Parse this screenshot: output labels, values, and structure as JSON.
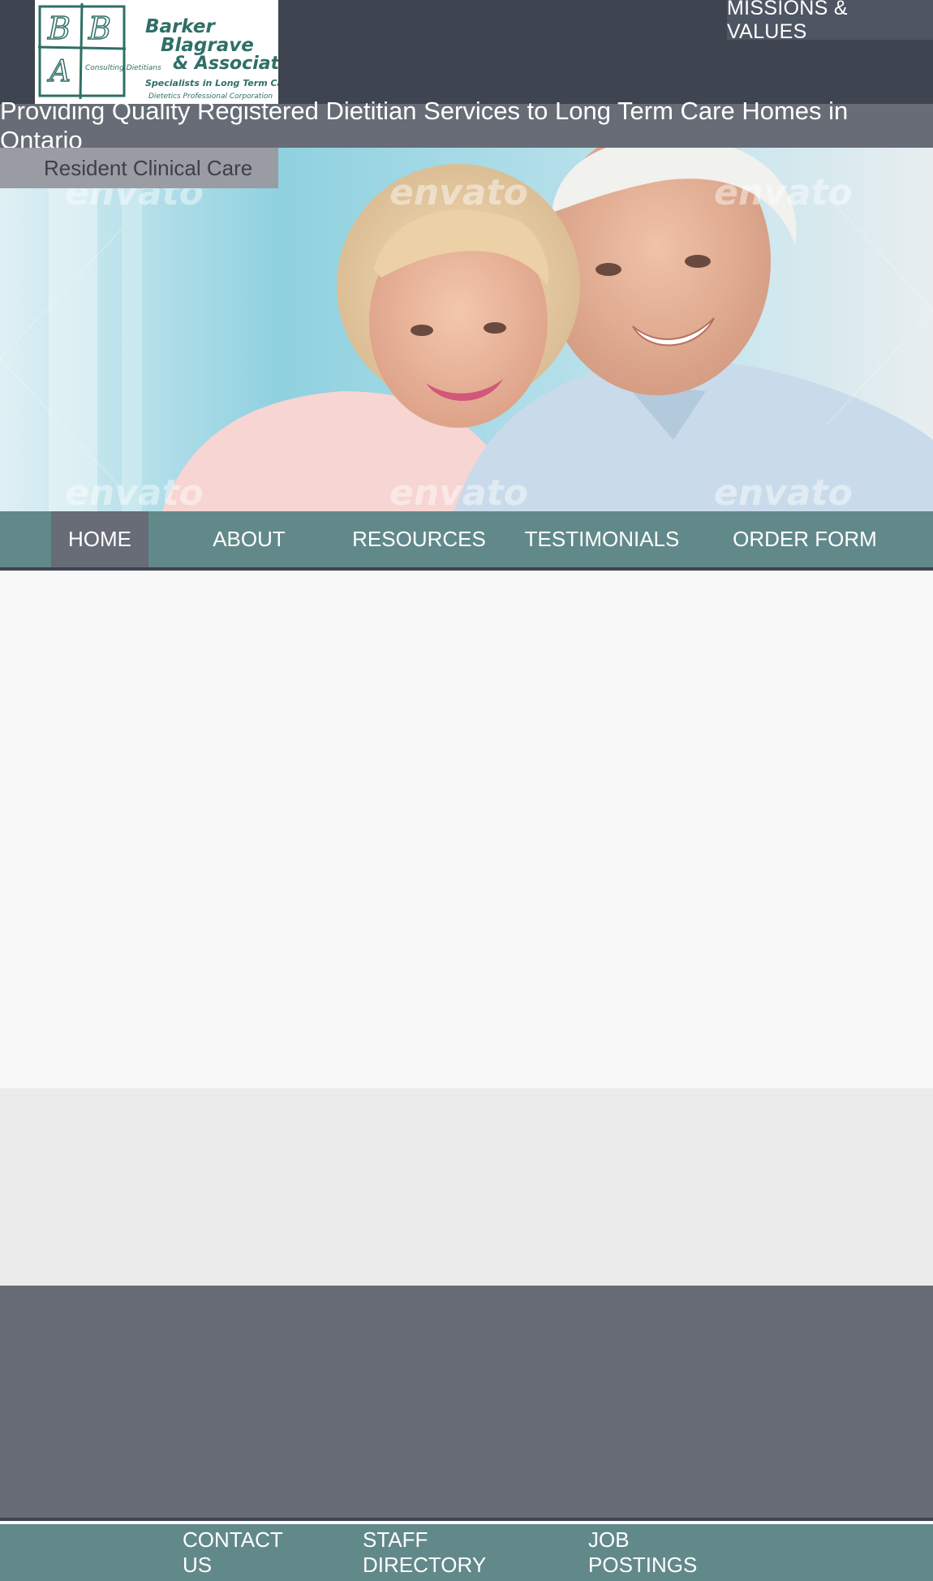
{
  "header": {
    "logo": {
      "line1": "Barker",
      "line2": "Blagrave",
      "line3": "& Associates",
      "line4": "Specialists in Long Term Care",
      "line5": "Dietetics Professional Corporation",
      "monogram_small": "Consulting Dietitians",
      "brand_color": "#2f6f66"
    },
    "missions_link": "MISSIONS & VALUES"
  },
  "tagline": "Providing Quality Registered Dietitian Services to Long Term Care Homes in Ontario",
  "hero": {
    "label": "Resident Clinical Care",
    "image": "smiling-senior-couple-photo",
    "watermark": "envato"
  },
  "main_nav": {
    "items": [
      {
        "label": "HOME",
        "active": true
      },
      {
        "label": "ABOUT",
        "active": false
      },
      {
        "label": "RESOURCES",
        "active": false
      },
      {
        "label": "TESTIMONIALS",
        "active": false
      },
      {
        "label": "ORDER FORM",
        "active": false
      }
    ]
  },
  "footer_nav": {
    "items": [
      {
        "label": "CONTACT US"
      },
      {
        "label": "STAFF DIRECTORY"
      },
      {
        "label": "JOB POSTINGS"
      }
    ]
  },
  "colors": {
    "header_bg": "#3e4450",
    "tagline_bg": "#676c76",
    "nav_bg": "#62898a",
    "active_bg": "#676c76",
    "content_bg": "#f8f8f8"
  }
}
